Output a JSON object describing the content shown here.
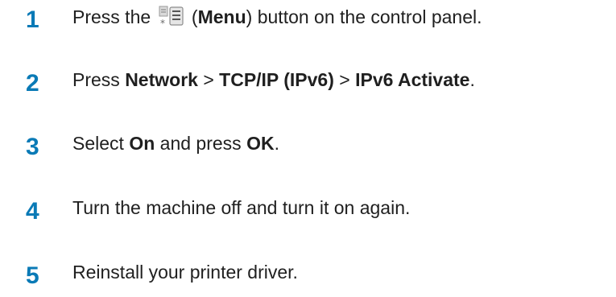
{
  "steps": [
    {
      "number": "1",
      "text_before": "Press the ",
      "icon": "menu-icon",
      "paren_open": " (",
      "bold_1": "Menu",
      "text_after": ") button on the control panel."
    },
    {
      "number": "2",
      "text_1": "Press ",
      "bold_1": "Network",
      "sep_1": " > ",
      "bold_2": "TCP/IP (IPv6)",
      "sep_2": " > ",
      "bold_3": "IPv6 Activate",
      "end": "."
    },
    {
      "number": "3",
      "text_1": "Select ",
      "bold_1": "On",
      "text_2": " and press ",
      "bold_2": "OK",
      "end": "."
    },
    {
      "number": "4",
      "text": "Turn the machine off and turn it on again."
    },
    {
      "number": "5",
      "text": "Reinstall your printer driver."
    }
  ],
  "colors": {
    "step_number": "#0a7ab6",
    "body_text": "#1f1f1f"
  }
}
